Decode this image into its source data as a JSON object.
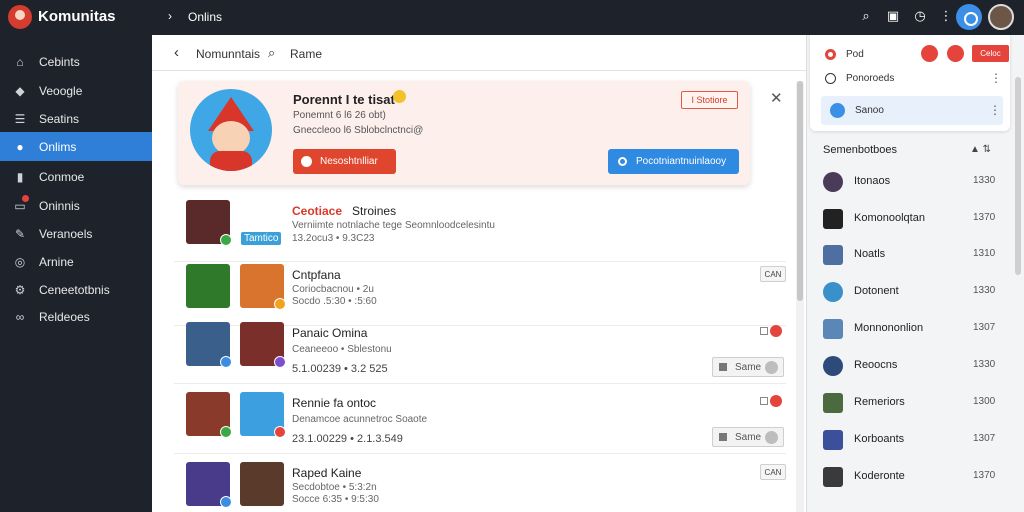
{
  "app": {
    "title": "Komunitas",
    "crumb": "Onlins"
  },
  "sidebar": {
    "items": [
      {
        "label": "Cebints",
        "icon": "home-icon"
      },
      {
        "label": "Veoogle",
        "icon": "tag-icon"
      },
      {
        "label": "Seatins",
        "icon": "list-icon"
      },
      {
        "label": "Onlims",
        "icon": "users-icon",
        "active": true
      },
      {
        "label": "Conmoe",
        "icon": "bookmark-icon"
      },
      {
        "label": "Oninnis",
        "icon": "folder-icon",
        "badge": true
      },
      {
        "label": "Veranoels",
        "icon": "pencil-icon"
      },
      {
        "label": "Arnine",
        "icon": "globe-icon"
      },
      {
        "label": "Ceneetotbnis",
        "icon": "settings-icon"
      },
      {
        "label": "Reldeoes",
        "icon": "link-icon"
      }
    ]
  },
  "subheader": {
    "title": "Nomunntais",
    "search_label": "Rame"
  },
  "feature": {
    "title": "Porennt I te tisat",
    "line1": "Ponemnt 6 l6 26 obt)",
    "line2": "Gneccleoo l6 Sblobclnctnci@",
    "primary_label": "Nesoshtnlliar",
    "tag": "I Stotiore",
    "secondary_label": "Pocotniantnuinlaooy"
  },
  "feed": [
    {
      "title_hl": "Ceotiace",
      "title": "Stroines",
      "line1": "Verniimte notnlache tege Seomnloodcelesintu",
      "tag": "Tamtico",
      "line2": "13.2ocu3 • 9.3C23",
      "badge": ""
    },
    {
      "title_hl": "",
      "title": "Cntpfana",
      "line1": "Coriocbacnou • 2u",
      "tag": "",
      "line2": "Socdo .5:30 • :5:60",
      "badge": "CAN"
    },
    {
      "title_hl": "",
      "title": "Panaic Omina",
      "line1": "Ceaneeoo • Sblestonu",
      "tag": "",
      "line2": "5.1.00239 • 3.2 525",
      "badge": "",
      "save": "Same"
    },
    {
      "title_hl": "",
      "title": "Rennie fa ontoc",
      "line1": "Denamcoe acunnetroc Soaote",
      "tag": "",
      "line2": "23.1.00229 • 2.1.3.549",
      "badge": "",
      "save": "Same"
    },
    {
      "title_hl": "",
      "title": "Raped Kaine",
      "line1": "Secdobtoe • 5:3:2n",
      "tag": "",
      "line2": "Socce 6:35 • 9:5:30",
      "badge": "CAN"
    }
  ],
  "right": {
    "top_row_label": "Pod",
    "search_label": "Ponoroeds",
    "active_label": "Sanoo",
    "red_button": "Celoc",
    "section_title": "Semenbotboes",
    "friends": [
      {
        "name": "Itonaos",
        "time": "1330",
        "color": "#4a3b59"
      },
      {
        "name": "Komonoolqtan",
        "time": "1370",
        "color": "#222222"
      },
      {
        "name": "Noatls",
        "time": "1310",
        "color": "#4e6fa0"
      },
      {
        "name": "Dotonent",
        "time": "1330",
        "color": "#3a90c8"
      },
      {
        "name": "Monnononlion",
        "time": "1307",
        "color": "#5b87b8"
      },
      {
        "name": "Reoocns",
        "time": "1330",
        "color": "#2d4a7a"
      },
      {
        "name": "Remeriors",
        "time": "1300",
        "color": "#4b6a40"
      },
      {
        "name": "Korboants",
        "time": "1307",
        "color": "#3c4f9a"
      },
      {
        "name": "Koderonte",
        "time": "1370",
        "color": "#3a3a3a"
      }
    ]
  }
}
